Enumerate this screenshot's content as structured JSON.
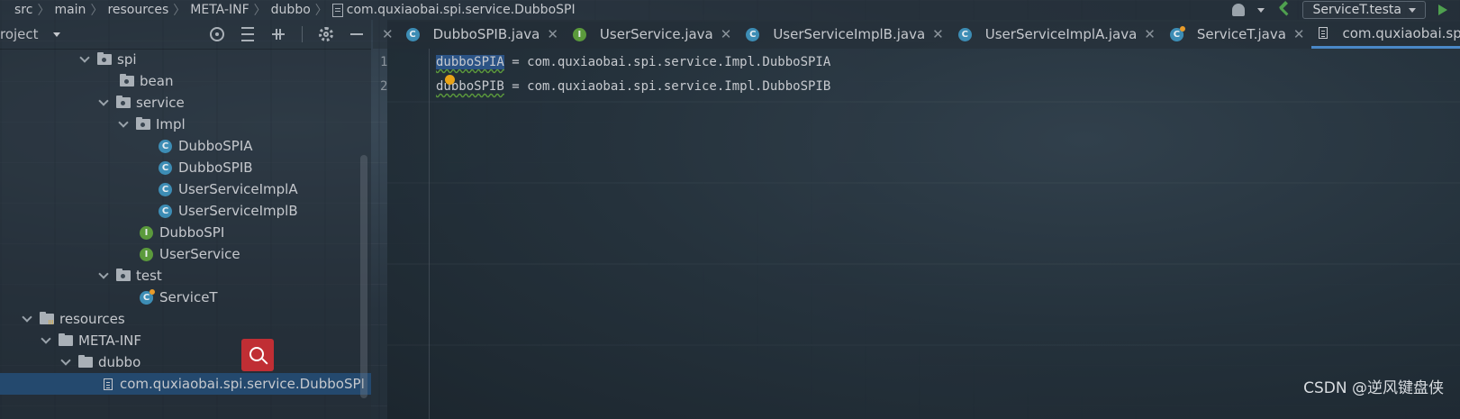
{
  "breadcrumb": {
    "items": [
      "src",
      "main",
      "resources",
      "META-INF",
      "dubbo"
    ],
    "file": "com.quxiaobai.spi.service.DubboSPI"
  },
  "run_config": {
    "label": "ServiceT.testa"
  },
  "project": {
    "title": "roject",
    "tree": [
      {
        "label": "spi",
        "type": "package",
        "expanded": true
      },
      {
        "label": "bean",
        "type": "package"
      },
      {
        "label": "service",
        "type": "package",
        "expanded": true
      },
      {
        "label": "Impl",
        "type": "package",
        "expanded": true
      },
      {
        "label": "DubboSPIA",
        "type": "class"
      },
      {
        "label": "DubboSPIB",
        "type": "class"
      },
      {
        "label": "UserServiceImplA",
        "type": "class"
      },
      {
        "label": "UserServiceImplB",
        "type": "class"
      },
      {
        "label": "DubboSPI",
        "type": "interface"
      },
      {
        "label": "UserService",
        "type": "interface"
      },
      {
        "label": "test",
        "type": "package",
        "expanded": true
      },
      {
        "label": "ServiceT",
        "type": "test-class"
      },
      {
        "label": "resources",
        "type": "resources",
        "expanded": true
      },
      {
        "label": "META-INF",
        "type": "folder",
        "expanded": true
      },
      {
        "label": "dubbo",
        "type": "folder",
        "expanded": true
      },
      {
        "label": "com.quxiaobai.spi.service.DubboSPI",
        "type": "file",
        "selected": true
      }
    ]
  },
  "tabs": [
    {
      "label": "DubboSPIB.java",
      "icon": "class-icon"
    },
    {
      "label": "UserService.java",
      "icon": "interface-icon"
    },
    {
      "label": "UserServiceImplB.java",
      "icon": "class-icon"
    },
    {
      "label": "UserServiceImplA.java",
      "icon": "class-icon"
    },
    {
      "label": "ServiceT.java",
      "icon": "test-class-icon"
    },
    {
      "label": "com.quxiaobai.spi.serv",
      "icon": "file-icon",
      "active": true
    }
  ],
  "editor": {
    "lines": [
      {
        "num": "1",
        "key": "dubboSPIA",
        "rest": " = com.quxiaobai.spi.service.Impl.DubboSPIA"
      },
      {
        "num": "2",
        "key": "dubboSPIB",
        "rest": " = com.quxiaobai.spi.service.Impl.DubboSPIB"
      }
    ]
  },
  "watermark": "CSDN @逆风键盘侠",
  "colors": {
    "accent": "#4a88c7",
    "selection": "#24496e",
    "run": "#4fa04f",
    "floating_search": "#c02e34"
  }
}
